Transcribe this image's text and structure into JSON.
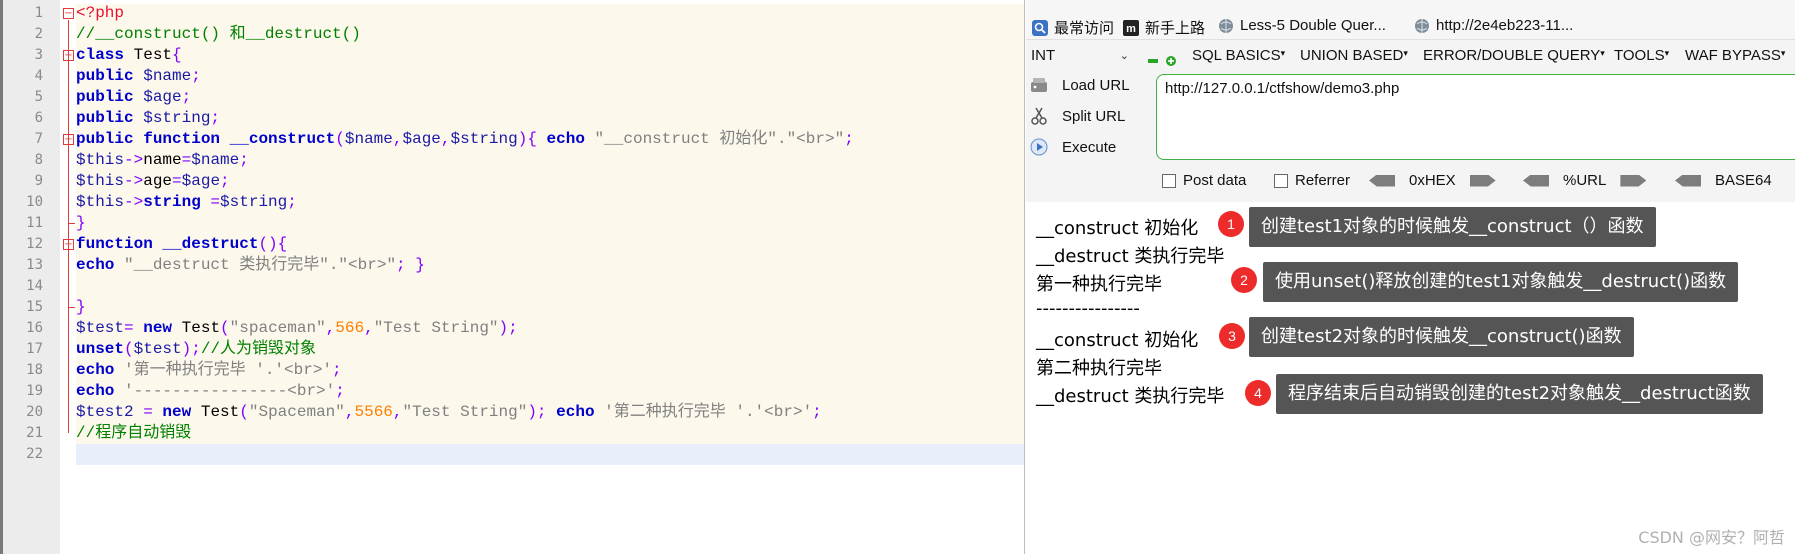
{
  "editor": {
    "line_numbers": [
      "1",
      "2",
      "3",
      "4",
      "5",
      "6",
      "7",
      "8",
      "9",
      "10",
      "11",
      "12",
      "13",
      "14",
      "15",
      "16",
      "17",
      "18",
      "19",
      "20",
      "21",
      "22"
    ],
    "lines": [
      [
        {
          "t": "<?php",
          "c": "tag"
        }
      ],
      [
        {
          "t": "//__construct() 和__destruct()",
          "c": "cmt"
        }
      ],
      [
        {
          "t": "class",
          "c": "kw"
        },
        {
          "t": " Test",
          "c": "fn"
        },
        {
          "t": "{",
          "c": "op"
        }
      ],
      [
        {
          "t": "public",
          "c": "kw"
        },
        {
          "t": " $name",
          "c": "var"
        },
        {
          "t": ";",
          "c": "op"
        }
      ],
      [
        {
          "t": "public",
          "c": "kw"
        },
        {
          "t": " $age",
          "c": "var"
        },
        {
          "t": ";",
          "c": "op"
        }
      ],
      [
        {
          "t": "public",
          "c": "kw"
        },
        {
          "t": " $string",
          "c": "var"
        },
        {
          "t": ";",
          "c": "op"
        }
      ],
      [
        {
          "t": "public",
          "c": "kw"
        },
        {
          "t": " ",
          "c": "fn"
        },
        {
          "t": "function",
          "c": "kw"
        },
        {
          "t": " ",
          "c": "fn"
        },
        {
          "t": "__construct",
          "c": "kw"
        },
        {
          "t": "(",
          "c": "op"
        },
        {
          "t": "$name",
          "c": "var"
        },
        {
          "t": ",",
          "c": "op"
        },
        {
          "t": "$age",
          "c": "var"
        },
        {
          "t": ",",
          "c": "op"
        },
        {
          "t": "$string",
          "c": "var"
        },
        {
          "t": "){ ",
          "c": "op"
        },
        {
          "t": "echo",
          "c": "kw"
        },
        {
          "t": " \"__construct 初始化\".\"<br>\"",
          "c": "str"
        },
        {
          "t": ";",
          "c": "op"
        }
      ],
      [
        {
          "t": "$this",
          "c": "var"
        },
        {
          "t": "->",
          "c": "op"
        },
        {
          "t": "name",
          "c": "fn"
        },
        {
          "t": "=",
          "c": "op"
        },
        {
          "t": "$name",
          "c": "var"
        },
        {
          "t": ";",
          "c": "op"
        }
      ],
      [
        {
          "t": "$this",
          "c": "var"
        },
        {
          "t": "->",
          "c": "op"
        },
        {
          "t": "age",
          "c": "fn"
        },
        {
          "t": "=",
          "c": "op"
        },
        {
          "t": "$age",
          "c": "var"
        },
        {
          "t": ";",
          "c": "op"
        }
      ],
      [
        {
          "t": "$this",
          "c": "var"
        },
        {
          "t": "->",
          "c": "op"
        },
        {
          "t": "string",
          "c": "kw"
        },
        {
          "t": " =",
          "c": "op"
        },
        {
          "t": "$string",
          "c": "var"
        },
        {
          "t": ";",
          "c": "op"
        }
      ],
      [
        {
          "t": "}",
          "c": "op"
        }
      ],
      [
        {
          "t": "function",
          "c": "kw"
        },
        {
          "t": " ",
          "c": "fn"
        },
        {
          "t": "__destruct",
          "c": "kw"
        },
        {
          "t": "(){",
          "c": "op"
        }
      ],
      [
        {
          "t": "echo",
          "c": "kw"
        },
        {
          "t": " \"__destruct 类执行完毕\".\"<br>\"",
          "c": "str"
        },
        {
          "t": "; }",
          "c": "op"
        }
      ],
      [
        {
          "t": "",
          "c": "fn"
        }
      ],
      [
        {
          "t": "}",
          "c": "op"
        }
      ],
      [
        {
          "t": "$test",
          "c": "var"
        },
        {
          "t": "= ",
          "c": "op"
        },
        {
          "t": "new",
          "c": "kw"
        },
        {
          "t": " Test",
          "c": "fn"
        },
        {
          "t": "(",
          "c": "op"
        },
        {
          "t": "\"spaceman\"",
          "c": "str"
        },
        {
          "t": ",",
          "c": "op"
        },
        {
          "t": "566",
          "c": "num"
        },
        {
          "t": ",",
          "c": "op"
        },
        {
          "t": "\"Test String\"",
          "c": "str"
        },
        {
          "t": ");",
          "c": "op"
        }
      ],
      [
        {
          "t": "unset",
          "c": "kw"
        },
        {
          "t": "(",
          "c": "op"
        },
        {
          "t": "$test",
          "c": "var"
        },
        {
          "t": ");",
          "c": "op"
        },
        {
          "t": "//人为销毁对象",
          "c": "cmt"
        }
      ],
      [
        {
          "t": "echo",
          "c": "kw"
        },
        {
          "t": " '第一种执行完毕 '.'<br>'",
          "c": "str"
        },
        {
          "t": ";",
          "c": "op"
        }
      ],
      [
        {
          "t": "echo",
          "c": "kw"
        },
        {
          "t": " '----------------<br>'",
          "c": "str"
        },
        {
          "t": ";",
          "c": "op"
        }
      ],
      [
        {
          "t": "$test2",
          "c": "var"
        },
        {
          "t": " = ",
          "c": "op"
        },
        {
          "t": "new",
          "c": "kw"
        },
        {
          "t": " Test",
          "c": "fn"
        },
        {
          "t": "(",
          "c": "op"
        },
        {
          "t": "\"Spaceman\"",
          "c": "str"
        },
        {
          "t": ",",
          "c": "op"
        },
        {
          "t": "5566",
          "c": "num"
        },
        {
          "t": ",",
          "c": "op"
        },
        {
          "t": "\"Test String\"",
          "c": "str"
        },
        {
          "t": "); ",
          "c": "op"
        },
        {
          "t": "echo",
          "c": "kw"
        },
        {
          "t": " '第二种执行完毕 '.'<br>'",
          "c": "str"
        },
        {
          "t": ";",
          "c": "op"
        }
      ],
      [
        {
          "t": "//程序自动销毁",
          "c": "cmt"
        }
      ],
      [
        {
          "t": "",
          "c": "fn"
        }
      ]
    ]
  },
  "colors": {
    "keyword": "#0000cc",
    "variable": "#1a1aa6",
    "string": "#808080",
    "number": "#ff7f00",
    "comment": "#008000",
    "php_tag": "#e8112d",
    "fold_marker": "#e23b3b",
    "callout_bg": "#555555",
    "badge": "#ee2b2b",
    "url_border": "#3cb043"
  },
  "browser": {
    "bookmarks": [
      {
        "label": "最常访问",
        "icon": "search-icon"
      },
      {
        "label": "新手上路",
        "icon": "m-logo-icon"
      },
      {
        "label": "Less-5 Double Quer...",
        "icon": "globe-icon"
      },
      {
        "label": "http://2e4eb223-11...",
        "icon": "globe-icon"
      }
    ],
    "hackbar": {
      "select_value": "INT",
      "menu": [
        "SQL BASICS",
        "UNION BASED",
        "ERROR/DOUBLE QUERY",
        "TOOLS",
        "WAF BYPASS"
      ],
      "actions": [
        {
          "label": "Load URL",
          "icon": "load-icon"
        },
        {
          "label": "Split URL",
          "icon": "scissors-icon"
        },
        {
          "label": "Execute",
          "icon": "play-icon"
        }
      ],
      "url": "http://127.0.0.1/ctfshow/demo3.php",
      "checkboxes": [
        "Post data",
        "Referrer"
      ],
      "encoders": [
        "0xHEX",
        "%URL",
        "BASE64"
      ]
    },
    "output_lines": [
      "__construct 初始化",
      "__destruct 类执行完毕",
      "第一种执行完毕",
      "----------------",
      "__construct 初始化",
      "第二种执行完毕",
      "__destruct 类执行完毕"
    ],
    "callouts": [
      {
        "num": "1",
        "text": "创建test1对象的时候触发__construct（）函数"
      },
      {
        "num": "2",
        "text": "使用unset()释放创建的test1对象触发__destruct()函数"
      },
      {
        "num": "3",
        "text": "创建test2对象的时候触发__construct()函数"
      },
      {
        "num": "4",
        "text": "程序结束后自动销毁创建的test2对象触发__destruct函数"
      }
    ],
    "watermark": "CSDN @网安？阿哲"
  }
}
